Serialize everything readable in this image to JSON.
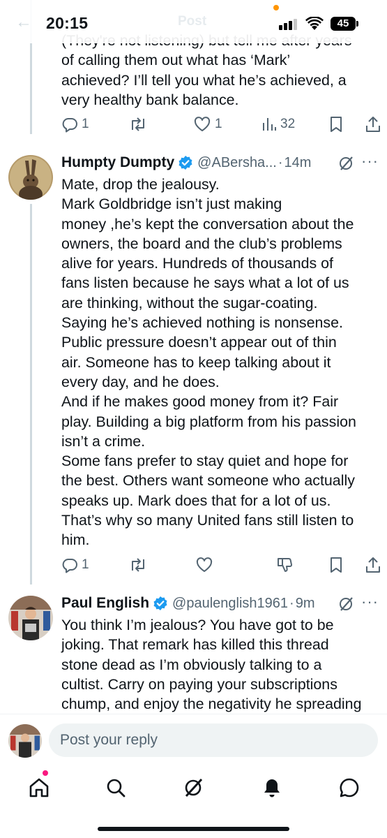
{
  "status_bar": {
    "time": "20:15",
    "battery": "45",
    "ghost_title": "Post",
    "ghost_back": "←"
  },
  "tweets": [
    {
      "text": "(They're not listening) but tell me after years\nof calling them out what has ‘Mark’\nachieved? I’ll tell you what he’s achieved, a\nvery healthy bank balance.",
      "replies": "1",
      "reposts": "",
      "likes": "1",
      "views": "32"
    },
    {
      "author": "Humpty Dumpty",
      "handle": "@ABersha...",
      "time": "14m",
      "text": "Mate, drop the jealousy.\nMark Goldbridge isn’t just making\nmoney ,he’s kept the conversation about the\nowners, the board and the club’s problems\nalive for years. Hundreds of thousands of\nfans listen because he says what a lot of us\nare thinking, without the sugar-coating.\nSaying he’s achieved nothing is nonsense.\nPublic pressure doesn’t appear out of thin\nair. Someone has to keep talking about it\nevery day, and he does.\nAnd if he makes good money from it? Fair\nplay. Building a big platform from his passion\nisn’t a crime.\nSome fans prefer to stay quiet and hope for\nthe best. Others want someone who actually\nspeaks up. Mark does that for a lot of us.\nThat’s why so many United fans still listen to\nhim.",
      "replies": "1"
    },
    {
      "author": "Paul English",
      "handle": "@paulenglish1961",
      "time": "9m",
      "text": "You think I’m jealous? You have got to be\njoking. That remark has killed this thread\nstone dead as I’m obviously talking to a\ncultist. Carry on paying your subscriptions\nchump, and enjoy the negativity he spreading"
    }
  ],
  "reply_bar": {
    "placeholder": "Post your reply"
  },
  "icons": {
    "status": [
      "signal-icon",
      "wifi-icon",
      "battery-icon"
    ],
    "actions": [
      "reply-icon",
      "repost-icon",
      "like-icon",
      "views-icon",
      "dislike-icon",
      "bookmark-icon",
      "share-icon"
    ],
    "header": [
      "verified-icon",
      "grok-icon",
      "more-icon"
    ],
    "tabs": [
      "home-icon",
      "search-icon",
      "grok-icon",
      "notifications-icon",
      "messages-icon"
    ]
  },
  "colors": {
    "text": "#0f1419",
    "secondary": "#536471",
    "verified": "#1d9bf0",
    "notification_dot": "#f91880",
    "input_bg": "#eff3f4"
  }
}
